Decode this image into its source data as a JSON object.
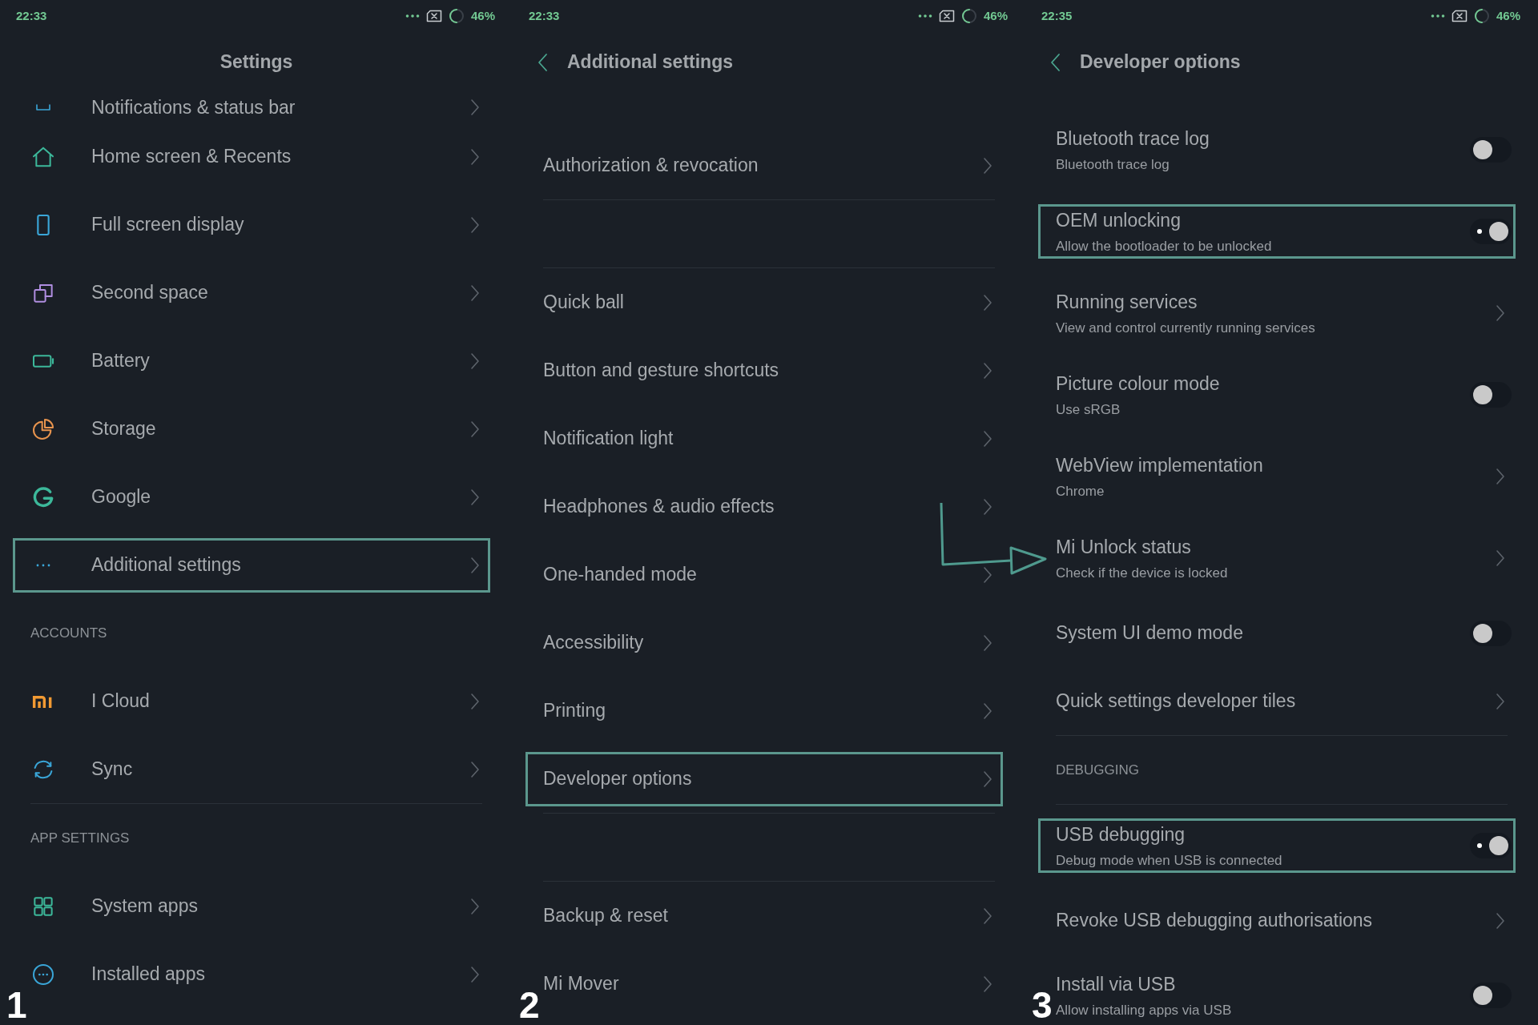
{
  "panels": [
    {
      "number": "1",
      "status_bar": {
        "time": "22:33",
        "battery": "46%"
      },
      "header": {
        "title": "Settings",
        "back": false
      },
      "items": [
        {
          "kind": "peek",
          "label": "Notifications & status bar",
          "highlighted": false
        },
        {
          "kind": "nav",
          "label": "Home screen & Recents",
          "highlighted": false
        },
        {
          "kind": "nav",
          "label": "Full screen display",
          "highlighted": false
        },
        {
          "kind": "nav",
          "label": "Second space",
          "highlighted": false
        },
        {
          "kind": "nav",
          "label": "Battery",
          "highlighted": false
        },
        {
          "kind": "nav",
          "label": "Storage",
          "highlighted": false
        },
        {
          "kind": "nav",
          "label": "Google",
          "highlighted": false
        },
        {
          "kind": "nav",
          "label": "Additional settings",
          "highlighted": true
        },
        {
          "kind": "section",
          "label": "ACCOUNTS"
        },
        {
          "kind": "nav",
          "label": "I Cloud",
          "highlighted": false
        },
        {
          "kind": "nav",
          "label": "Sync",
          "highlighted": false,
          "divider_below": true
        },
        {
          "kind": "section",
          "label": "APP SETTINGS"
        },
        {
          "kind": "nav",
          "label": "System apps",
          "highlighted": false
        },
        {
          "kind": "nav",
          "label": "Installed apps",
          "highlighted": false
        }
      ]
    },
    {
      "number": "2",
      "status_bar": {
        "time": "22:33",
        "battery": "46%"
      },
      "header": {
        "title": "Additional settings",
        "back": true
      },
      "items": [
        {
          "kind": "nav",
          "label": "Authorization & revocation",
          "highlighted": false,
          "divider_below": true
        },
        {
          "kind": "gap",
          "divider_below": true
        },
        {
          "kind": "nav",
          "label": "Quick ball",
          "highlighted": false
        },
        {
          "kind": "nav",
          "label": "Button and gesture shortcuts",
          "highlighted": false
        },
        {
          "kind": "nav",
          "label": "Notification light",
          "highlighted": false
        },
        {
          "kind": "nav",
          "label": "Headphones & audio effects",
          "highlighted": false
        },
        {
          "kind": "nav",
          "label": "One-handed mode",
          "highlighted": false
        },
        {
          "kind": "nav",
          "label": "Accessibility",
          "highlighted": false
        },
        {
          "kind": "nav",
          "label": "Printing",
          "highlighted": false
        },
        {
          "kind": "nav",
          "label": "Developer options",
          "highlighted": true,
          "divider_below": true
        },
        {
          "kind": "gap",
          "divider_below": true
        },
        {
          "kind": "nav",
          "label": "Backup & reset",
          "highlighted": false
        },
        {
          "kind": "nav",
          "label": "Mi Mover",
          "highlighted": false
        }
      ]
    },
    {
      "number": "3",
      "status_bar": {
        "time": "22:35",
        "battery": "46%"
      },
      "header": {
        "title": "Developer options",
        "back": true
      },
      "items": [
        {
          "kind": "toggle",
          "label": "Bluetooth trace log",
          "sub": "Bluetooth trace log",
          "on": false,
          "highlighted": false
        },
        {
          "kind": "toggle",
          "label": "OEM unlocking",
          "sub": "Allow the bootloader to be unlocked",
          "on": true,
          "highlighted": true
        },
        {
          "kind": "nav",
          "label": "Running services",
          "sub": "View and control currently running services",
          "highlighted": false
        },
        {
          "kind": "toggle",
          "label": "Picture colour mode",
          "sub": "Use sRGB",
          "on": false,
          "highlighted": false
        },
        {
          "kind": "nav",
          "label": "WebView implementation",
          "sub": "Chrome",
          "highlighted": false
        },
        {
          "kind": "nav",
          "label": "Mi Unlock status",
          "sub": "Check if the device is locked",
          "highlighted": false
        },
        {
          "kind": "toggle",
          "label": "System UI demo mode",
          "on": false,
          "highlighted": false
        },
        {
          "kind": "nav",
          "label": "Quick settings developer tiles",
          "highlighted": false,
          "divider_below": true
        },
        {
          "kind": "section",
          "label": "DEBUGGING",
          "divider_below": true
        },
        {
          "kind": "toggle",
          "label": "USB debugging",
          "sub": "Debug mode when USB is connected",
          "on": true,
          "highlighted": true
        },
        {
          "kind": "nav",
          "label": "Revoke USB debugging authorisations",
          "highlighted": false
        },
        {
          "kind": "toggle",
          "label": "Install via USB",
          "sub": "Allow installing apps via USB",
          "on": false,
          "highlighted": false
        }
      ]
    }
  ]
}
